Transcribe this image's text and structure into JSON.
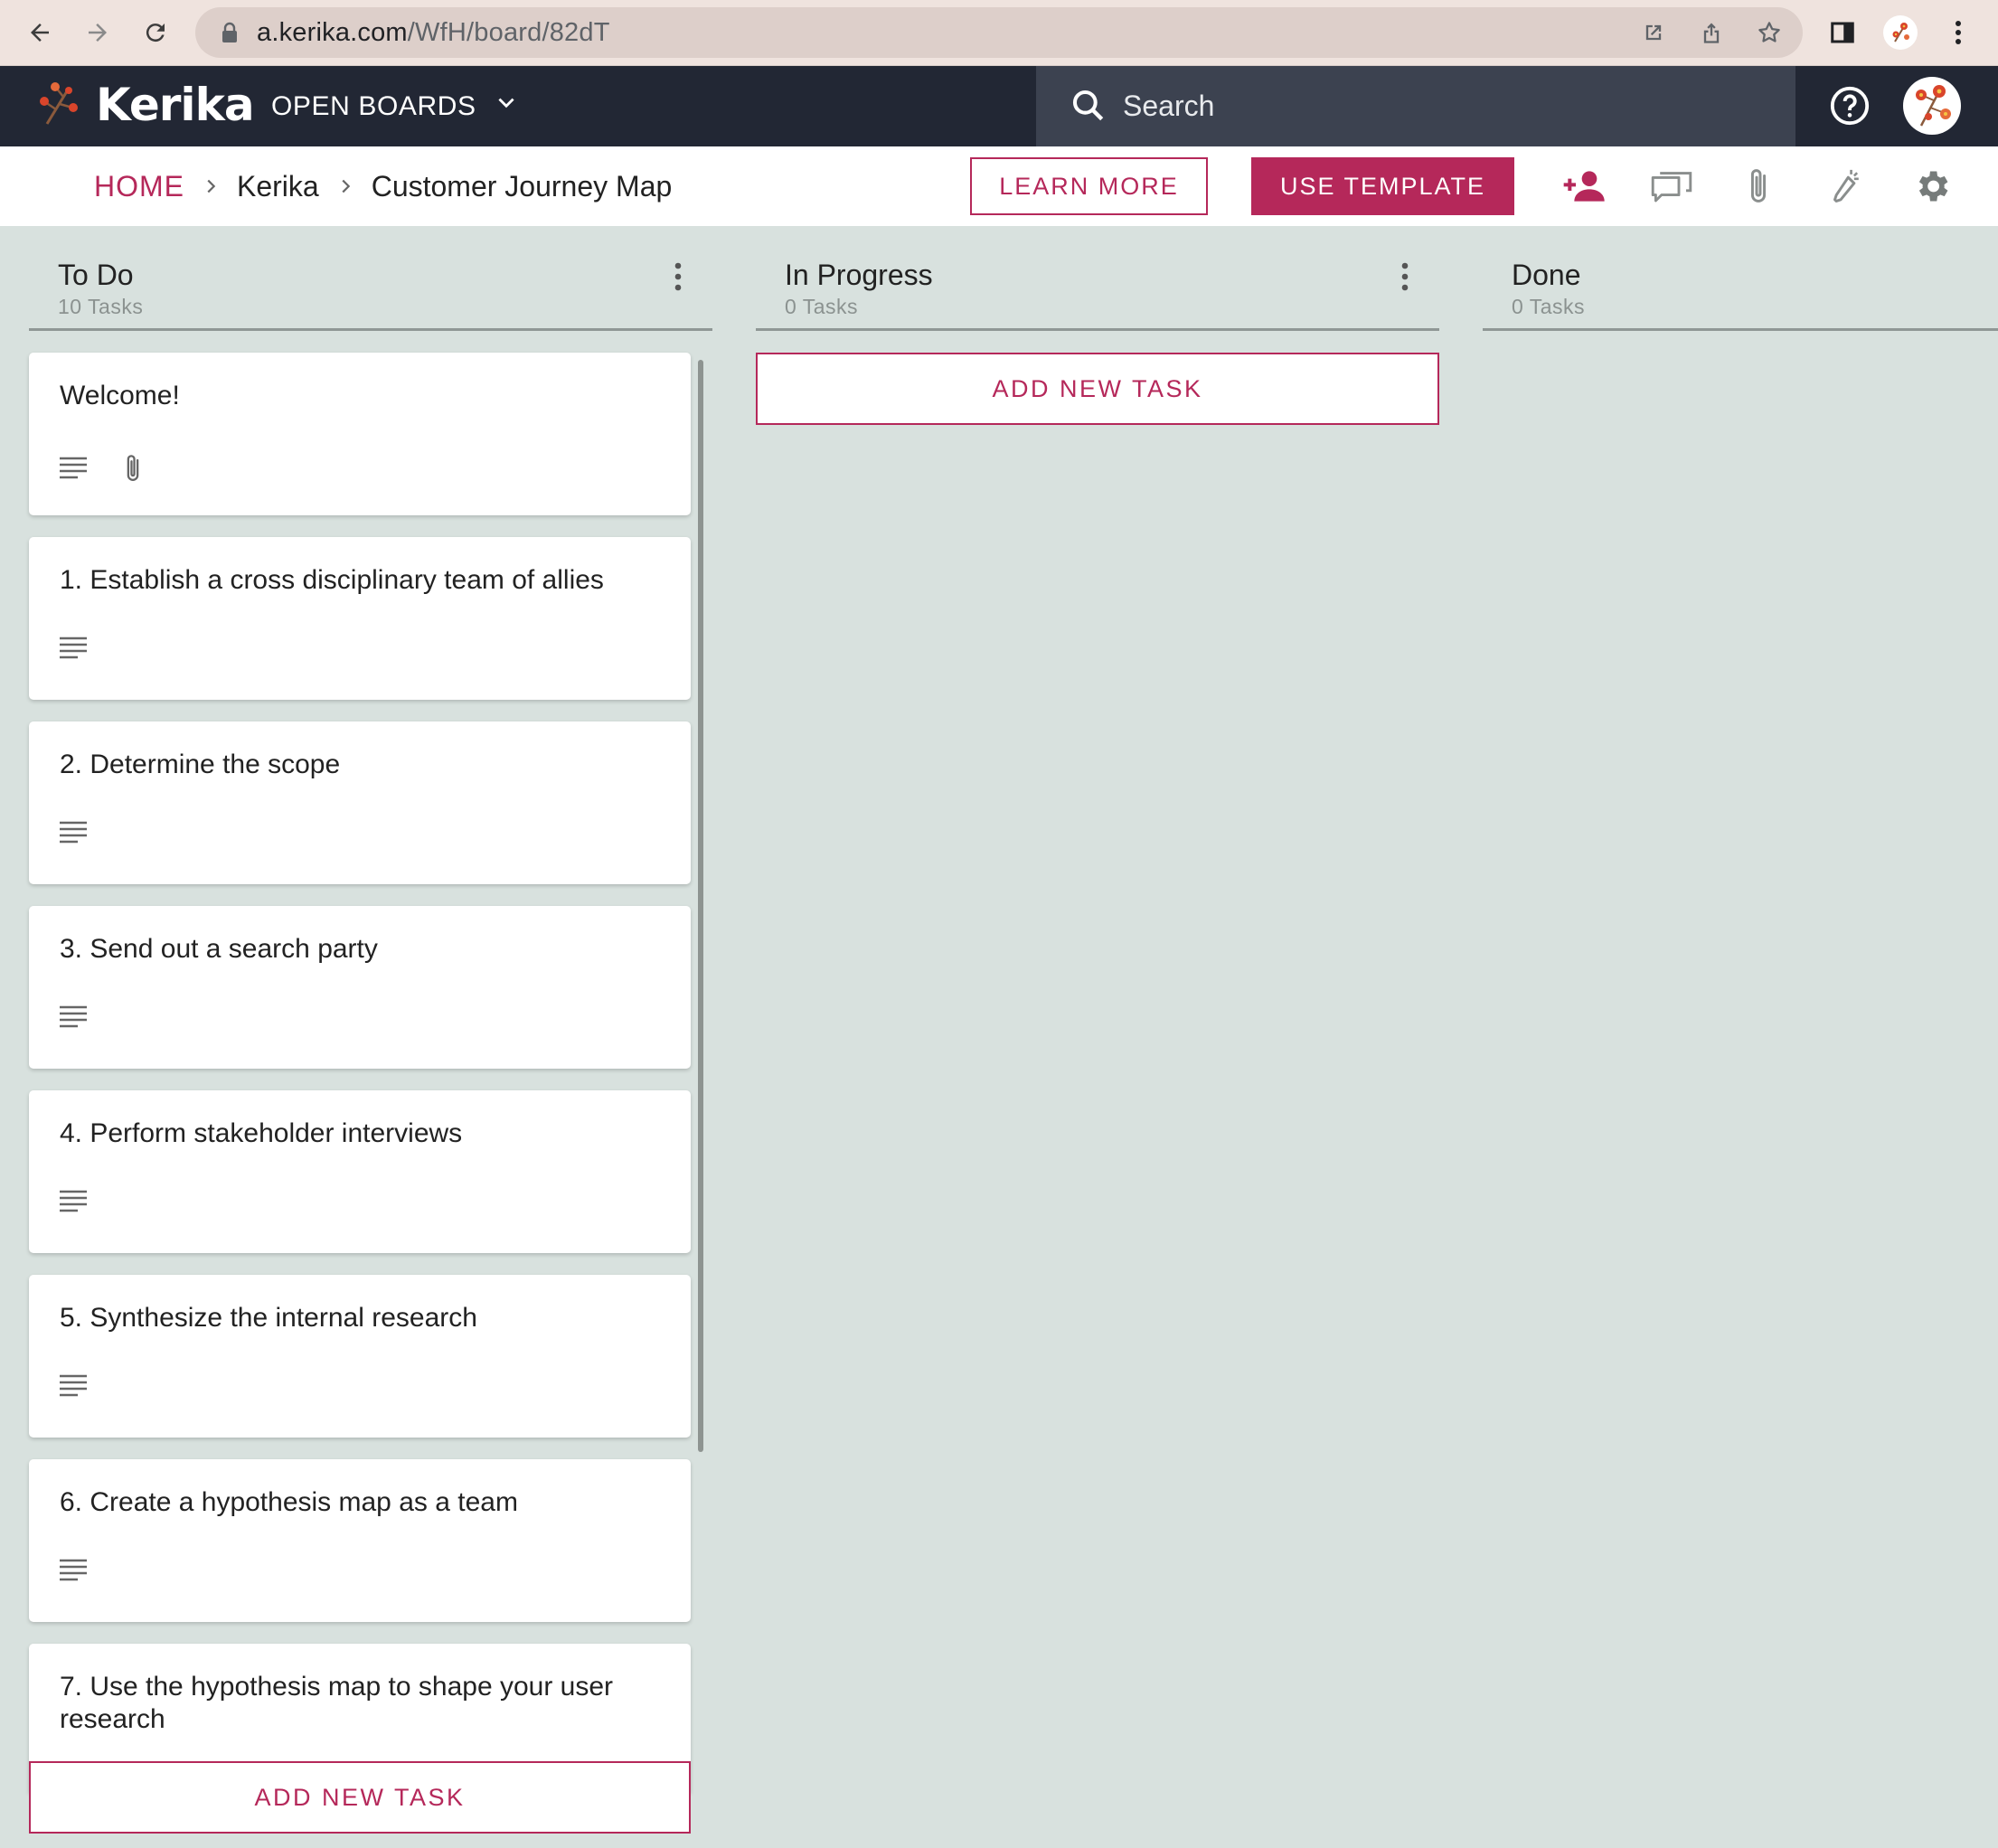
{
  "browser": {
    "url_host": "a.kerika.com",
    "url_path": "/WfH/board/82dT"
  },
  "app": {
    "logo": "Kerika",
    "open_boards": "OPEN BOARDS",
    "search_placeholder": "Search"
  },
  "breadcrumb": {
    "home": "HOME",
    "org": "Kerika",
    "board": "Customer Journey Map"
  },
  "actions": {
    "learn_more": "LEARN MORE",
    "use_template": "USE TEMPLATE"
  },
  "columns": [
    {
      "title": "To Do",
      "count": "10 Tasks",
      "add_label": "ADD NEW TASK",
      "cards": [
        {
          "title": "Welcome!",
          "icons": [
            "description-icon",
            "attachment-icon"
          ]
        },
        {
          "title": "1. Establish a cross disciplinary team of allies",
          "icons": [
            "description-icon"
          ]
        },
        {
          "title": "2. Determine the scope",
          "icons": [
            "description-icon"
          ]
        },
        {
          "title": "3. Send out a search party",
          "icons": [
            "description-icon"
          ]
        },
        {
          "title": "4. Perform stakeholder interviews",
          "icons": [
            "description-icon"
          ]
        },
        {
          "title": "5. Synthesize the internal research",
          "icons": [
            "description-icon"
          ]
        },
        {
          "title": "6. Create a hypothesis map as a team",
          "icons": [
            "description-icon"
          ]
        },
        {
          "title": "7. Use the hypothesis map to shape your user research",
          "icons": []
        }
      ]
    },
    {
      "title": "In Progress",
      "count": "0 Tasks",
      "add_label": "ADD NEW TASK",
      "cards": []
    },
    {
      "title": "Done",
      "count": "0 Tasks",
      "cards": []
    }
  ],
  "colors": {
    "accent": "#b5285a",
    "appbar": "#222734",
    "board_bg": "#d8e1de"
  }
}
